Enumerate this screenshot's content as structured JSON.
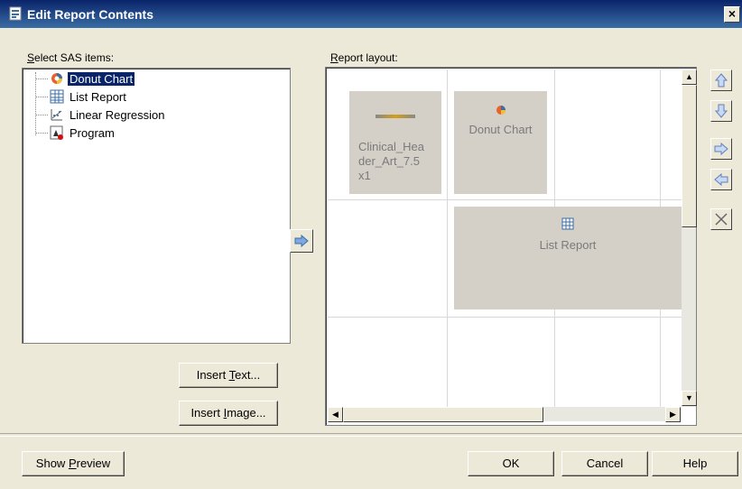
{
  "window": {
    "title": "Edit Report Contents",
    "close_glyph": "×"
  },
  "left": {
    "label_prefix": "S",
    "label_rest": "elect SAS items:",
    "tree": [
      {
        "label": "Donut Chart",
        "icon": "donut-chart-icon",
        "selected": true
      },
      {
        "label": "List Report",
        "icon": "list-report-icon",
        "selected": false
      },
      {
        "label": "Linear Regression",
        "icon": "linear-regression-icon",
        "selected": false
      },
      {
        "label": "Program",
        "icon": "program-icon",
        "selected": false
      }
    ],
    "insert_text_prefix": "Insert ",
    "insert_text_key": "T",
    "insert_text_rest": "ext...",
    "insert_image_prefix": "Insert ",
    "insert_image_key": "I",
    "insert_image_rest": "mage..."
  },
  "right": {
    "label_prefix": "R",
    "label_rest": "eport layout:",
    "cells": [
      {
        "label": "Clinical_Hea der_Art_7.5 x1"
      },
      {
        "label": "Donut Chart"
      },
      {
        "label": "List Report"
      }
    ]
  },
  "side_buttons": [
    "up-arrow-icon",
    "down-arrow-icon",
    "right-arrow-icon",
    "left-arrow-icon",
    "delete-x-icon"
  ],
  "footer": {
    "show_preview_prefix": "Show ",
    "show_preview_key": "P",
    "show_preview_rest": "review",
    "ok": "OK",
    "cancel": "Cancel",
    "help": "Help"
  }
}
